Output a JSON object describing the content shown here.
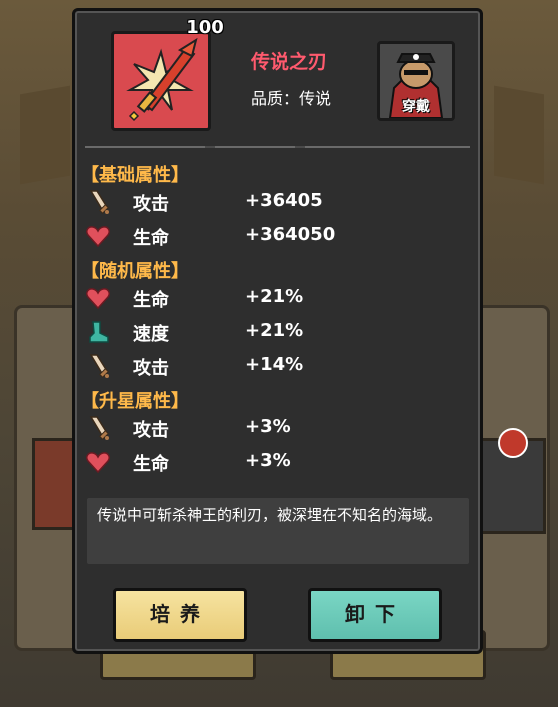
{
  "item": {
    "level": "100",
    "name": "传说之刃",
    "quality": "品质：传说",
    "wearer_label": "穿戴",
    "description": "传说中可斩杀神王的利刃，被深埋在不知名的海域。"
  },
  "sections": {
    "base": {
      "title": "【基础属性】",
      "stats": [
        {
          "name": "攻击",
          "value": "+36405",
          "icon": "sword-icon"
        },
        {
          "name": "生命",
          "value": "+364050",
          "icon": "heart-icon"
        }
      ]
    },
    "random": {
      "title": "【随机属性】",
      "stats": [
        {
          "name": "生命",
          "value": "+21%",
          "icon": "heart-icon"
        },
        {
          "name": "速度",
          "value": "+21%",
          "icon": "boot-icon"
        },
        {
          "name": "攻击",
          "value": "+14%",
          "icon": "sword-icon"
        }
      ]
    },
    "star": {
      "title": "【升星属性】",
      "stats": [
        {
          "name": "攻击",
          "value": "+3%",
          "icon": "sword-icon"
        },
        {
          "name": "生命",
          "value": "+3%",
          "icon": "heart-icon"
        }
      ]
    }
  },
  "buttons": {
    "cultivate": "培养",
    "unequip": "卸下"
  },
  "colors": {
    "panel": "#2e2e2e",
    "section_title": "#ffb94a",
    "item_name": "#ff5a6e",
    "cultivate_button": "#f1d98c",
    "unequip_button": "#6ccbb8"
  }
}
